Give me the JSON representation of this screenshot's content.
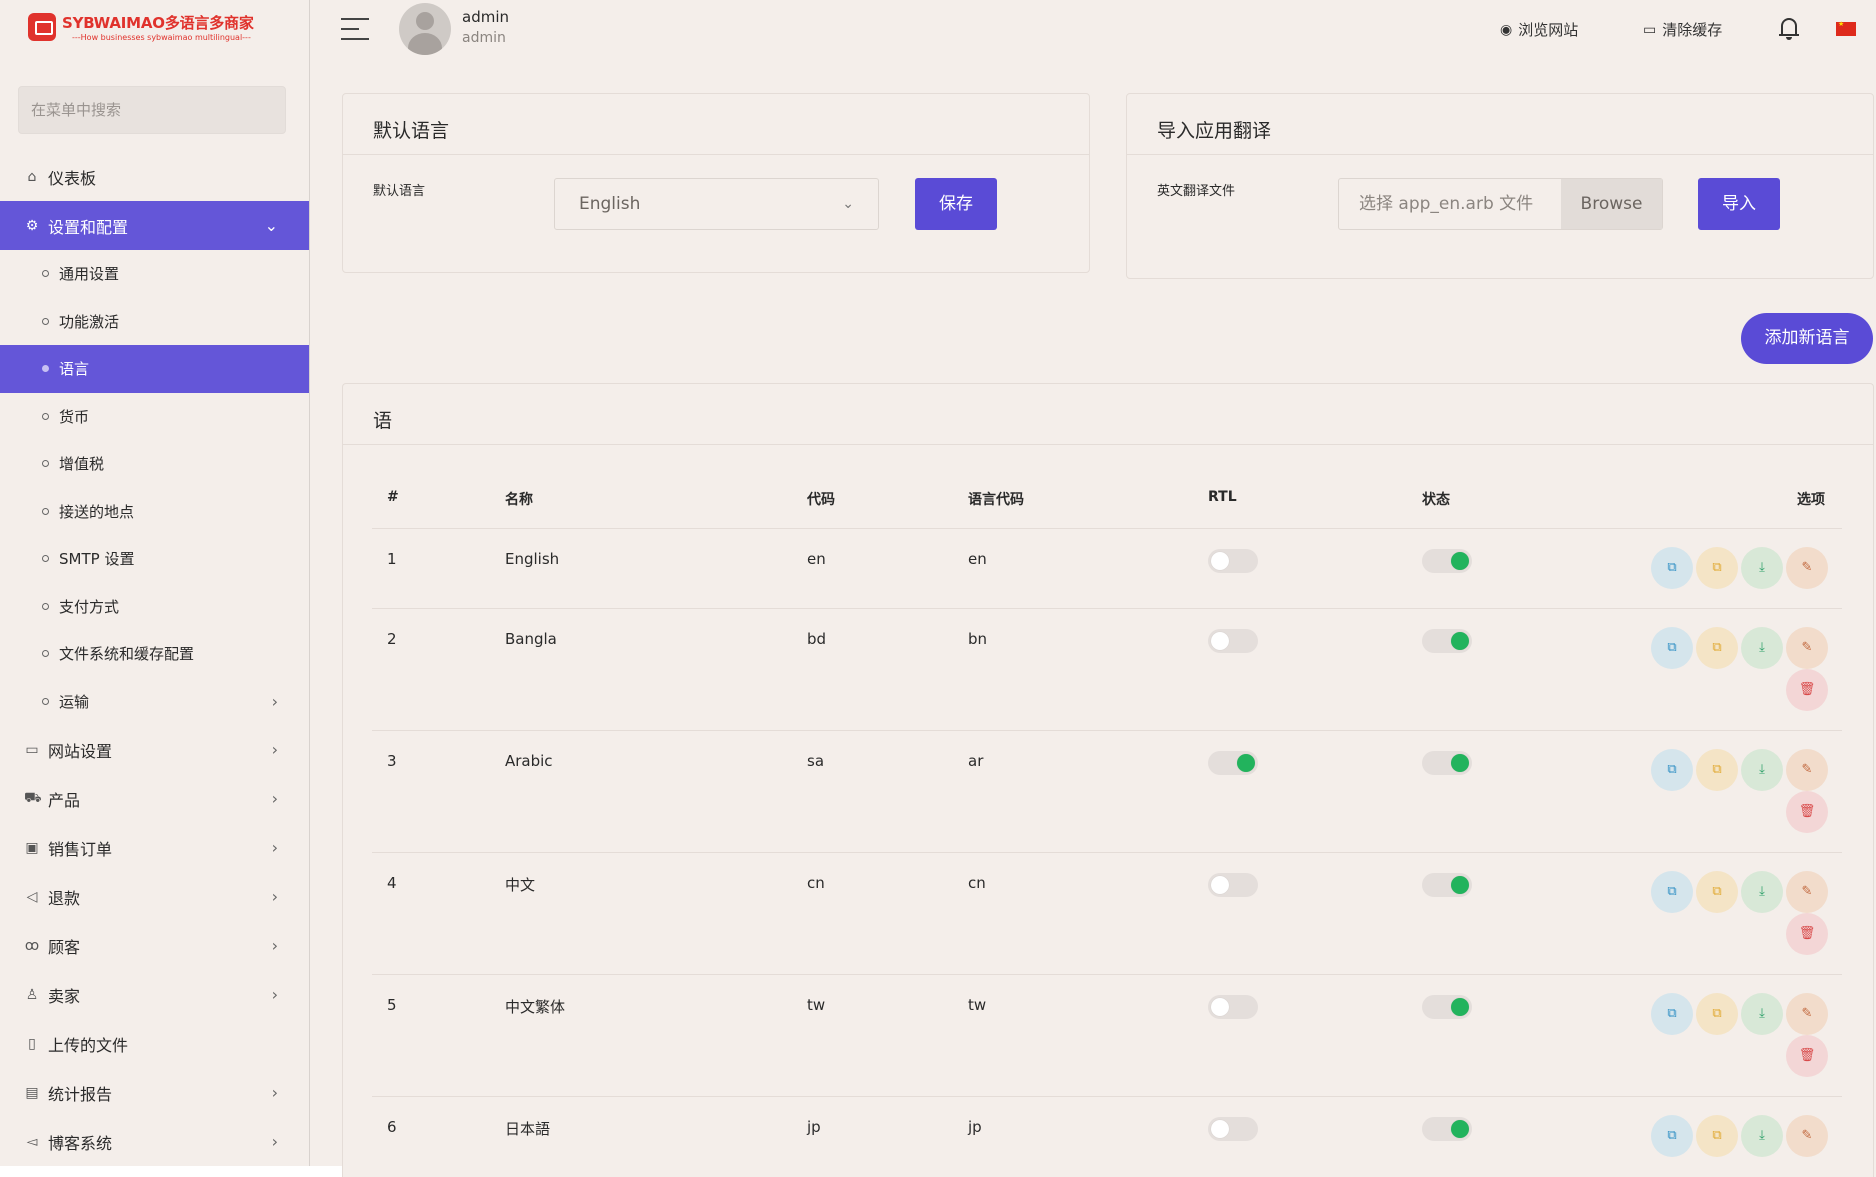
{
  "brand": {
    "title": "SYBWAIMAO多语言多商家",
    "subtitle": "---How businesses sybwaimao multilingual---"
  },
  "sidebar": {
    "search_placeholder": "在菜单中搜索",
    "items": [
      {
        "label": "仪表板",
        "icon": "home-icon"
      },
      {
        "label": "设置和配置",
        "icon": "gear-icon"
      },
      {
        "label": "网站设置",
        "icon": "monitor-icon"
      },
      {
        "label": "产品",
        "icon": "cart-icon"
      },
      {
        "label": "销售订单",
        "icon": "money-icon"
      },
      {
        "label": "退款",
        "icon": "rewind-icon"
      },
      {
        "label": "顾客",
        "icon": "users-icon"
      },
      {
        "label": "卖家",
        "icon": "user-icon"
      },
      {
        "label": "上传的文件",
        "icon": "file-icon"
      },
      {
        "label": "统计报告",
        "icon": "report-icon"
      },
      {
        "label": "博客系统",
        "icon": "megaphone-icon"
      }
    ],
    "sub_items": [
      "通用设置",
      "功能激活",
      "语言",
      "货币",
      "增值税",
      "接送的地点",
      "SMTP 设置",
      "支付方式",
      "文件系统和缓存配置",
      "运输"
    ]
  },
  "header": {
    "user_name": "admin",
    "user_role": "admin",
    "browse_site": "浏览网站",
    "clear_cache": "清除缓存"
  },
  "default_language_card": {
    "title": "默认语言",
    "field_label": "默认语言",
    "selected": "English",
    "save_label": "保存"
  },
  "import_card": {
    "title": "导入应用翻译",
    "field_label": "英文翻译文件",
    "file_placeholder": "选择 app_en.arb 文件",
    "browse_label": "Browse",
    "import_label": "导入"
  },
  "add_language_label": "添加新语言",
  "languages_table": {
    "title": "语",
    "columns": [
      "#",
      "名称",
      "代码",
      "语言代码",
      "RTL",
      "状态",
      "选项"
    ],
    "rows": [
      {
        "index": "1",
        "name": "English",
        "code": "en",
        "lang_code": "en",
        "rtl": false,
        "status": true
      },
      {
        "index": "2",
        "name": "Bangla",
        "code": "bd",
        "lang_code": "bn",
        "rtl": false,
        "status": true
      },
      {
        "index": "3",
        "name": "Arabic",
        "code": "sa",
        "lang_code": "ar",
        "rtl": true,
        "status": true
      },
      {
        "index": "4",
        "name": "中文",
        "code": "cn",
        "lang_code": "cn",
        "rtl": false,
        "status": true
      },
      {
        "index": "5",
        "name": "中文繁体",
        "code": "tw",
        "lang_code": "tw",
        "rtl": false,
        "status": true
      },
      {
        "index": "6",
        "name": "日本語",
        "code": "jp",
        "lang_code": "jp",
        "rtl": false,
        "status": true
      }
    ]
  },
  "colors": {
    "accent": "#5a4bd6",
    "toggle_on": "#22b35d",
    "background": "#f4eeea"
  }
}
